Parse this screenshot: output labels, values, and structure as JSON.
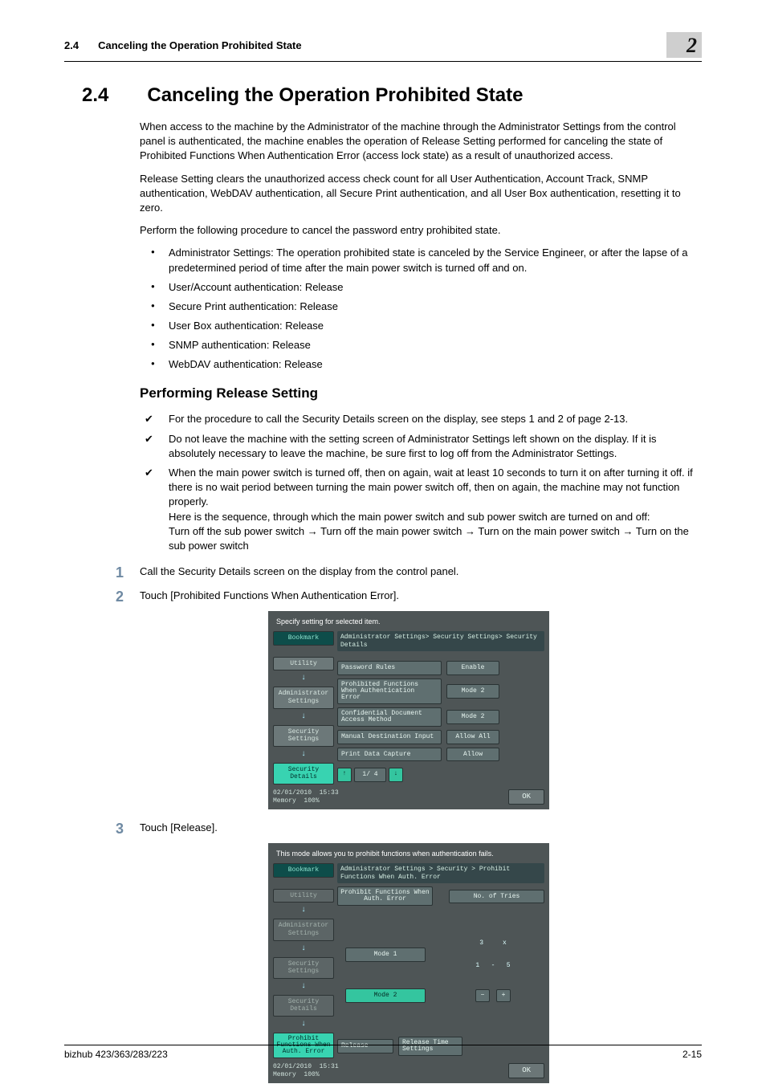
{
  "header": {
    "section_number": "2.4",
    "section_title_short": "Canceling the Operation Prohibited State",
    "chapter_number": "2"
  },
  "h2": {
    "number": "2.4",
    "title": "Canceling the Operation Prohibited State"
  },
  "intro": {
    "p1": "When access to the machine by the Administrator of the machine through the Administrator Settings from the control panel is authenticated, the machine enables the operation of Release Setting performed for canceling the state of Prohibited Functions When Authentication Error (access lock state) as a result of unauthorized access.",
    "p2": "Release Setting clears the unauthorized access check count for all User Authentication, Account Track, SNMP authentication, WebDAV authentication, all Secure Print authentication, and all User Box authentication, resetting it to zero.",
    "p3": "Perform the following procedure to cancel the password entry prohibited state."
  },
  "bullets": [
    "Administrator Settings: The operation prohibited state is canceled by the Service Engineer, or after the lapse of a predetermined period of time after the main power switch is turned off and on.",
    "User/Account authentication: Release",
    "Secure Print authentication: Release",
    "User Box authentication: Release",
    "SNMP authentication: Release",
    "WebDAV authentication: Release"
  ],
  "h3": "Performing Release Setting",
  "checks": [
    "For the procedure to call the Security Details screen on the display, see steps 1 and 2 of page 2-13.",
    "Do not leave the machine with the setting screen of Administrator Settings left shown on the display. If it is absolutely necessary to leave the machine, be sure first to log off from the Administrator Settings.",
    "When the main power switch is turned off, then on again, wait at least 10 seconds to turn it on after turning it off. if there is no wait period between turning the main power switch off, then on again, the machine may not function properly.\nHere is the sequence, through which the main power switch and sub power switch are turned on and off:\nTurn off the sub power switch → Turn off the main power switch → Turn on the main power switch → Turn on the sub power switch"
  ],
  "steps": [
    {
      "text": "Call the Security Details screen on the display from the control panel."
    },
    {
      "text": "Touch [Prohibited Functions When Authentication Error]."
    },
    {
      "text": "Touch [Release]."
    }
  ],
  "shot1": {
    "header": "Specify setting for selected item.",
    "breadcrumb": "Administrator Settings> Security Settings> Security Details",
    "side": {
      "bookmark": "Bookmark",
      "utility": "Utility",
      "admin": "Administrator Settings",
      "security": "Security Settings",
      "details": "Security Details"
    },
    "rows": [
      {
        "label": "Password Rules",
        "value": "Enable"
      },
      {
        "label": "Prohibited Functions When Authentication Error",
        "value": "Mode 2"
      },
      {
        "label": "Confidential Document Access Method",
        "value": "Mode 2"
      },
      {
        "label": "Manual Destination Input",
        "value": "Allow All"
      },
      {
        "label": "Print Data Capture",
        "value": "Allow"
      }
    ],
    "pager": {
      "up": "↑",
      "page": "1/ 4",
      "down": "↓"
    },
    "status": {
      "date": "02/01/2010",
      "time": "15:33",
      "memory_label": "Memory",
      "memory_value": "100%",
      "ok": "OK"
    }
  },
  "shot2": {
    "header": "This mode allows you to prohibit functions when authentication fails.",
    "breadcrumb": "Administrator Settings > Security > Prohibit Functions When Auth. Error",
    "col1": "Prohibit Functions When Auth. Error",
    "col2": "No. of Tries",
    "side": {
      "bookmark": "Bookmark",
      "utility": "Utility",
      "admin": "Administrator Settings",
      "security": "Security Settings",
      "details": "Security Details",
      "leaf": "Prohibit Functions When Auth. Error"
    },
    "mode1": "Mode 1",
    "mode2": "Mode 2",
    "release": "Release",
    "release_time": "Release Time Settings",
    "tries_display": "3     x",
    "tries_range": "1   -   5",
    "minus": "−",
    "plus": "+",
    "status": {
      "date": "02/01/2010",
      "time": "15:31",
      "memory_label": "Memory",
      "memory_value": "100%",
      "ok": "OK"
    }
  },
  "footer": {
    "product": "bizhub 423/363/283/223",
    "page": "2-15"
  }
}
